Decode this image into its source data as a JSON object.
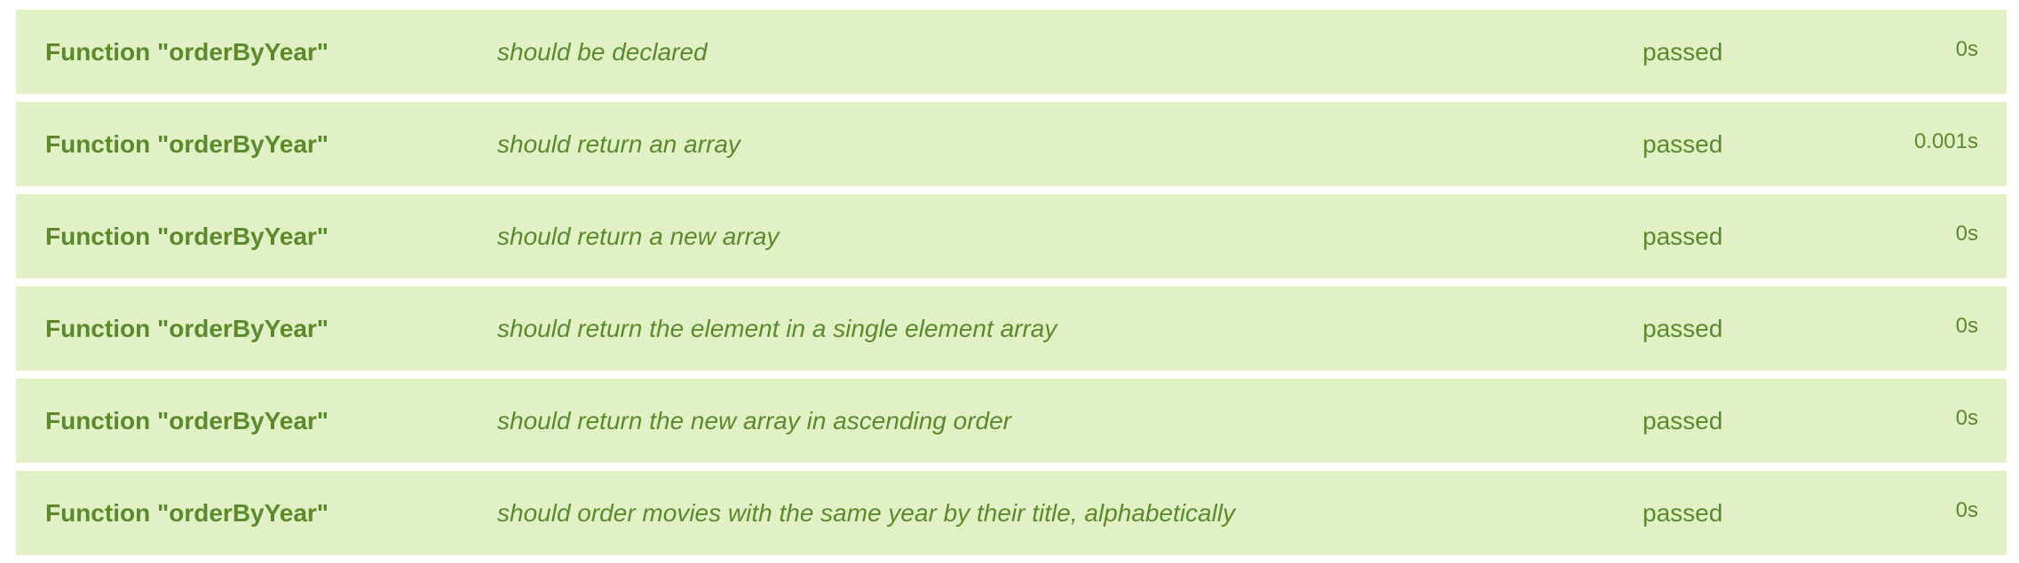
{
  "tests": [
    {
      "suite": "Function \"orderByYear\"",
      "title": "should be declared",
      "status": "passed",
      "duration": "0s"
    },
    {
      "suite": "Function \"orderByYear\"",
      "title": "should return an array",
      "status": "passed",
      "duration": "0.001s"
    },
    {
      "suite": "Function \"orderByYear\"",
      "title": "should return a new array",
      "status": "passed",
      "duration": "0s"
    },
    {
      "suite": "Function \"orderByYear\"",
      "title": "should return the element in a single element array",
      "status": "passed",
      "duration": "0s"
    },
    {
      "suite": "Function \"orderByYear\"",
      "title": "should return the new array in ascending order",
      "status": "passed",
      "duration": "0s"
    },
    {
      "suite": "Function \"orderByYear\"",
      "title": "should order movies with the same year by their title, alphabetically",
      "status": "passed",
      "duration": "0s"
    }
  ]
}
